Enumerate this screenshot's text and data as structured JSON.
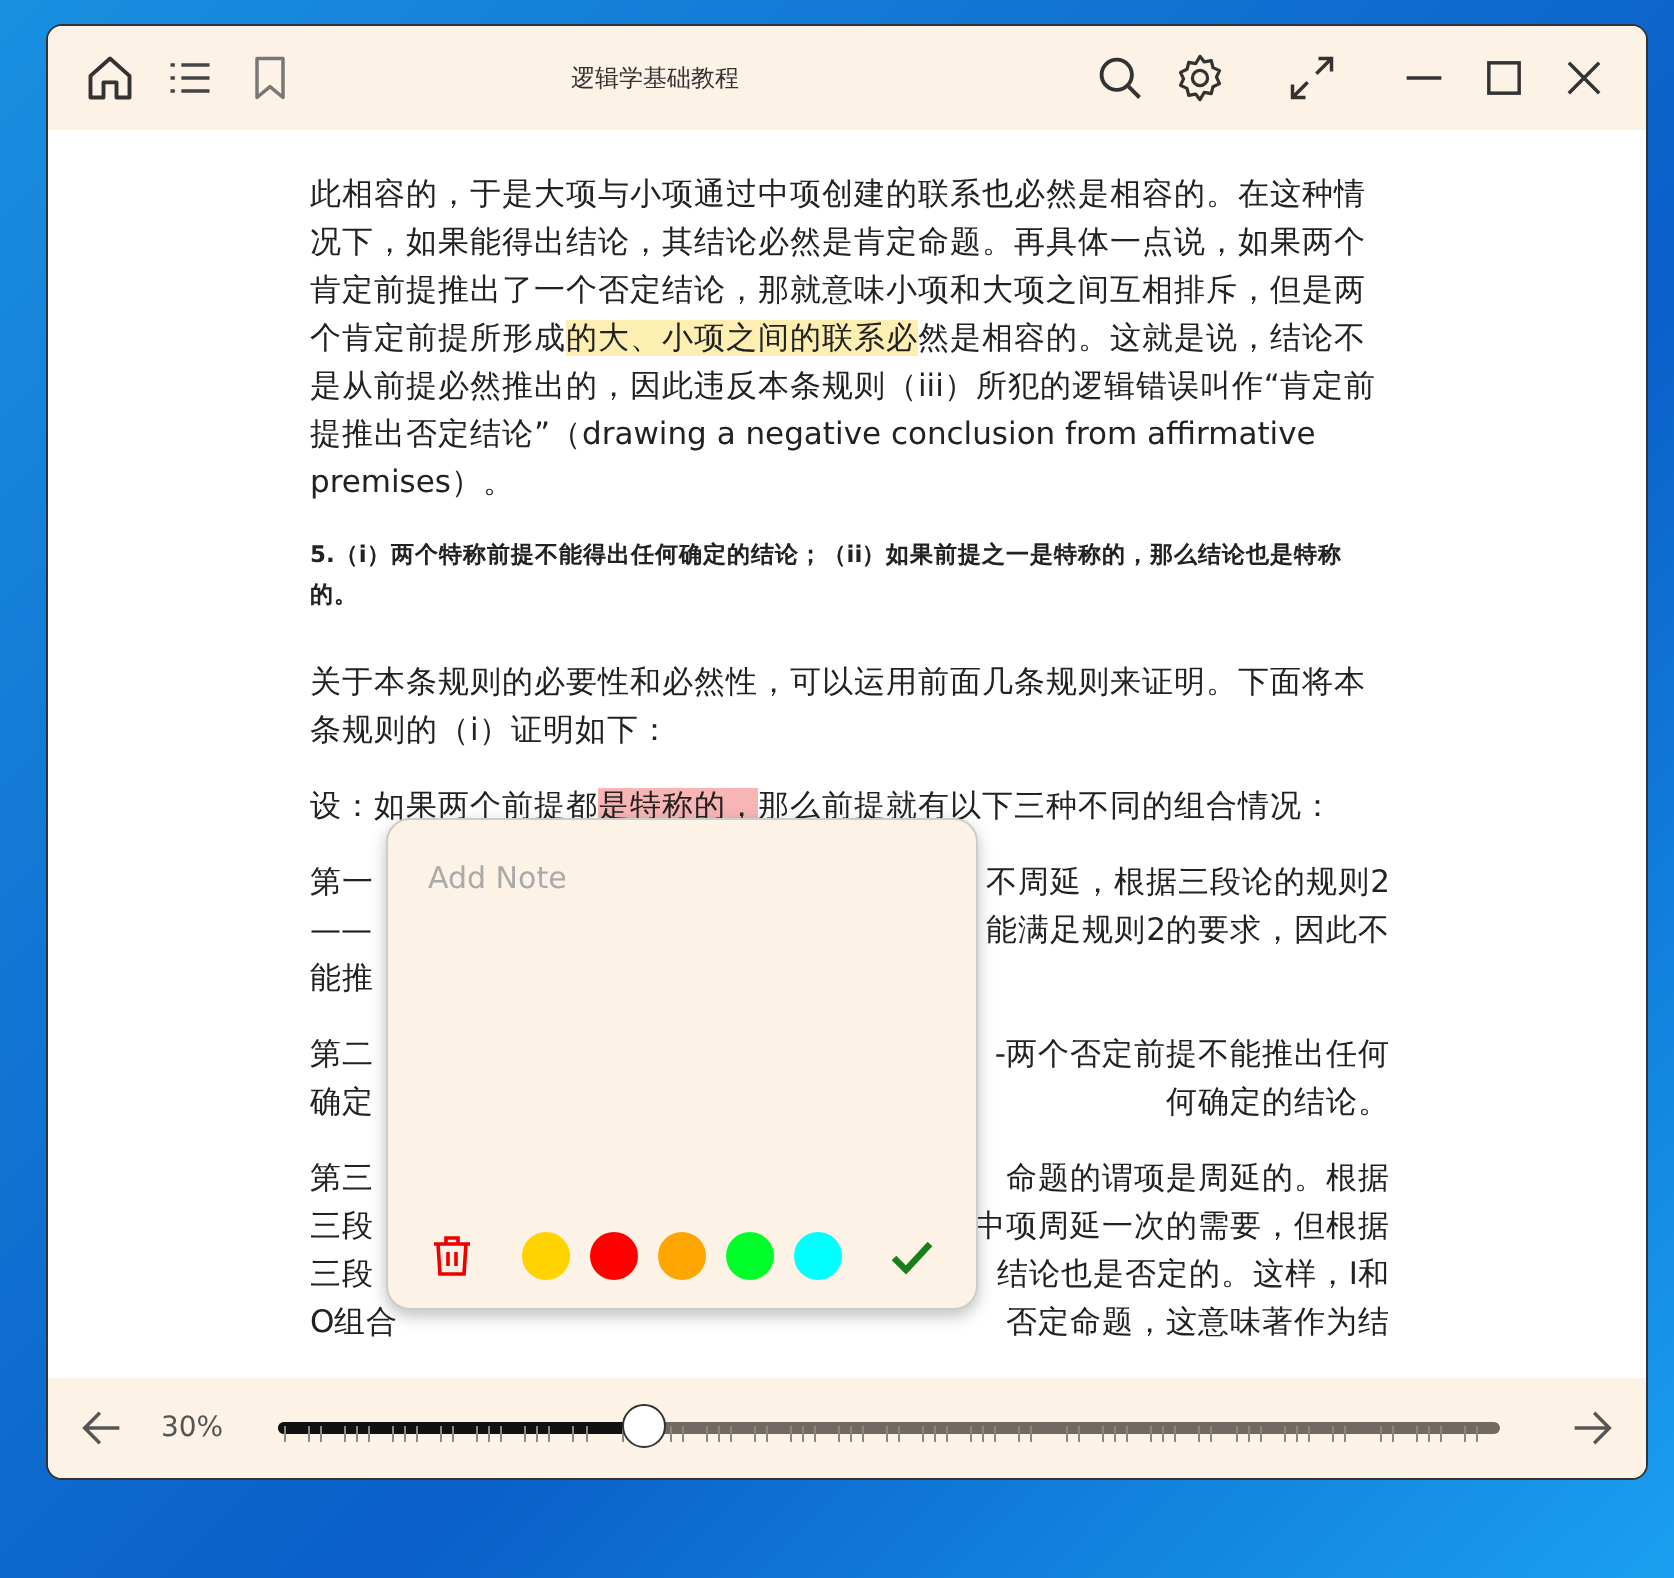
{
  "title": "逻辑学基础教程",
  "paragraphs": [
    {
      "kind": "text",
      "segments": [
        {
          "text": "此相容的，于是大项与小项通过中项创建的联系也必然是相容的。在这种情况下，如果能得出结论，其结论必然是肯定命题。再具体一点说，如果两个肯定前提推出了一个否定结论，那就意味小项和大项之间互相排斥，但是两个肯定前提所形成"
        },
        {
          "text": "的大、小项之间的联系必",
          "color": "#fdefb2"
        },
        {
          "text": "然是相容的。这就是说，结论不是从前提必然推出的，因此违反本条规则（iii）所犯的逻辑错误叫作“肯定前提推出否定结论”（drawing a negative conclusion from affirmative premises）。"
        }
      ]
    },
    {
      "kind": "heading",
      "text": "5.（i）两个特称前提不能得出任何确定的结论；（ii）如果前提之一是特称的，那么结论也是特称的。"
    },
    {
      "kind": "text",
      "segments": [
        {
          "text": "关于本条规则的必要性和必然性，可以运用前面几条规则来证明。下面将本条规则的（i）证明如下："
        }
      ]
    },
    {
      "kind": "text",
      "segments": [
        {
          "text": "设：如果两个前提都"
        },
        {
          "text": "是特称的，",
          "color": "#f8b5b5"
        },
        {
          "text": "那么前提就有以下三种不同的组合情况："
        }
      ]
    },
    {
      "kind": "split",
      "lines": [
        {
          "left": "第一",
          "right": "不周延，根据三段论的规则2"
        },
        {
          "left": "——",
          "right": "能满足规则2的要求，因此不"
        },
        {
          "left": "能推"
        }
      ]
    },
    {
      "kind": "split",
      "lines": [
        {
          "left": "第二",
          "right": "-两个否定前提不能推出任何"
        },
        {
          "left": "确定",
          "right": "何确定的结论。"
        }
      ]
    },
    {
      "kind": "split",
      "lines": [
        {
          "left": "第三",
          "right": "命题的谓项是周延的。根据"
        },
        {
          "left": "三段",
          "right": "中项周延一次的需要，但根据"
        },
        {
          "left": "三段",
          "right": "结论也是否定的。这样，I和"
        },
        {
          "left": "O组合",
          "right": "否定命题，这意味著作为结"
        }
      ]
    }
  ],
  "note": {
    "placeholder": "Add Note",
    "colors": [
      {
        "color": "#ffd200",
        "selected": false
      },
      {
        "color": "#ff0000",
        "selected": false
      },
      {
        "color": "#ffa500",
        "selected": false
      },
      {
        "color": "#00ff2a",
        "selected": false
      },
      {
        "color": "#00ffff",
        "selected": false
      }
    ]
  },
  "footer": {
    "percent": "30%",
    "level": 0.3
  }
}
